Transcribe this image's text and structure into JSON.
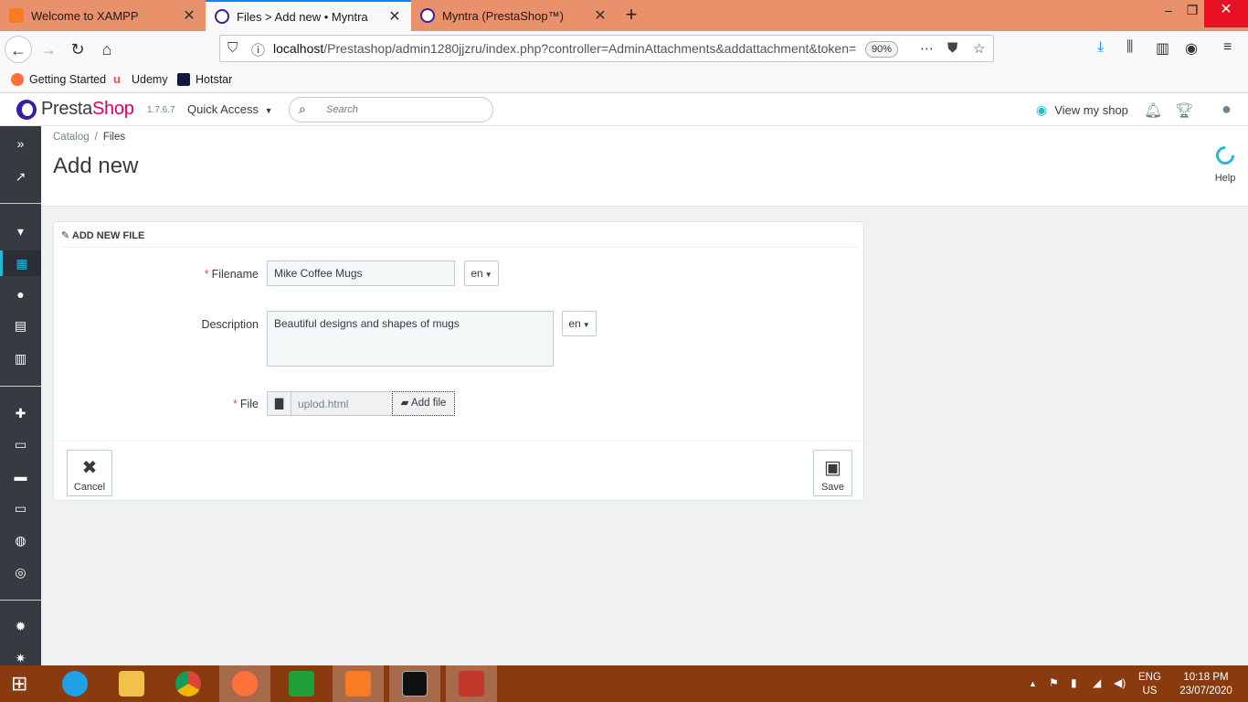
{
  "browser": {
    "tabs": [
      {
        "label": "Welcome to XAMPP",
        "active": false
      },
      {
        "label": "Files > Add new • Myntra",
        "active": true
      },
      {
        "label": "Myntra (PrestaShop™)",
        "active": false
      }
    ],
    "url_host": "localhost",
    "url_path": "/Prestashop/admin1280jjzru/index.php?controller=AdminAttachments&addattachment&token=",
    "zoom": "90%",
    "bookmarks": [
      "Getting Started",
      "Udemy",
      "Hotstar"
    ]
  },
  "ps_header": {
    "brand_pre": "Presta",
    "brand_post": "Shop",
    "version": "1.7.6.7",
    "quick_access": "Quick Access",
    "search_placeholder": "Search",
    "view_shop": "View my shop"
  },
  "page": {
    "breadcrumb": [
      "Catalog",
      "Files"
    ],
    "title": "Add new",
    "help": "Help"
  },
  "form": {
    "heading": "ADD NEW FILE",
    "filename_label": "Filename",
    "filename_value": "Mike Coffee Mugs",
    "lang": "en",
    "description_label": "Description",
    "description_value": "Beautiful designs and shapes of mugs",
    "file_label": "File",
    "file_value": "uplod.html",
    "add_file": "Add file",
    "cancel": "Cancel",
    "save": "Save"
  },
  "taskbar": {
    "lang_top": "ENG",
    "lang_bottom": "US",
    "time": "10:18 PM",
    "date": "23/07/2020"
  },
  "colors": {
    "tabbar": "#e8916a",
    "accent": "#25b9d7",
    "brand_pink": "#df0067",
    "sidebar": "#363a41",
    "taskbar": "#8a3a0f"
  }
}
